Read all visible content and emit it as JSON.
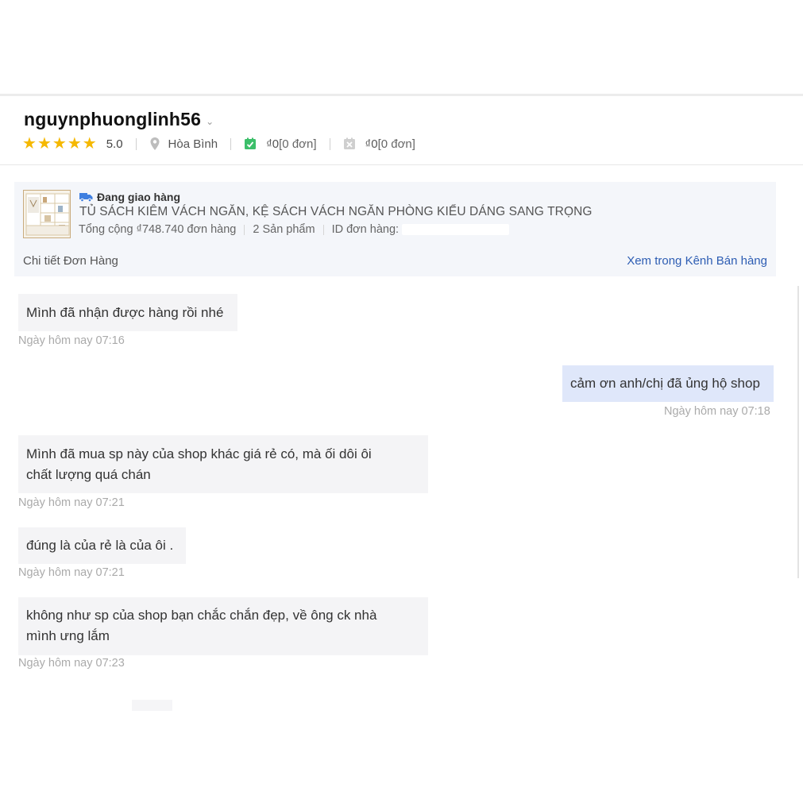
{
  "header": {
    "username": "nguynphuonglinh56",
    "rating": "5.0",
    "location": "Hòa Bình",
    "completed": {
      "currency": "₫0",
      "count": "[0 đơn]"
    },
    "cancelled": {
      "currency": "₫0",
      "count": "[0 đơn]"
    },
    "icons": {
      "stars": "star-icon",
      "location": "map-pin-icon",
      "completed": "check-box-icon",
      "cancelled": "x-box-icon",
      "expand": "chevron-down-icon"
    }
  },
  "order": {
    "status": "Đang giao hàng",
    "title": "TỦ SÁCH KIÊM VÁCH NGĂN, KỆ SÁCH VÁCH NGĂN PHÒNG KIỂU DÁNG SANG TRỌNG",
    "total": "Tổng cộng ₫748.740 đơn hàng",
    "products": "2 Sản phẩm",
    "id_label": "ID đơn hàng:",
    "detail_link": "Chi tiết Đơn Hàng",
    "channel_link": "Xem trong Kênh Bán hàng",
    "status_icon": "truck-icon"
  },
  "messages": [
    {
      "lines": [
        "Mình đã nhận được hàng rồi nhé"
      ],
      "time": "Ngày hôm nay 07:16",
      "side": "in"
    },
    {
      "lines": [
        "cảm ơn anh/chị đã ủng hộ shop"
      ],
      "time": "Ngày hôm nay 07:18",
      "side": "out"
    },
    {
      "lines": [
        "Mình đã mua sp này của shop khác giá rẻ có, mà ối dôi ôi",
        "chất lượng quá chán"
      ],
      "time": "Ngày hôm nay 07:21",
      "side": "in"
    },
    {
      "lines": [
        "đúng là của rẻ là của ôi ."
      ],
      "time": "Ngày hôm nay 07:21",
      "side": "in"
    },
    {
      "lines": [
        "không như sp của shop bạn chắc chắn đẹp, về ông ck nhà",
        "mình ưng lắm"
      ],
      "time": "Ngày hôm nay 07:23",
      "side": "in"
    }
  ],
  "colors": {
    "accent_link": "#2d5db3",
    "outgoing_bubble": "#dfe7fa",
    "incoming_bubble": "#f4f4f6",
    "star": "#f5b800",
    "check": "#3cbf6a"
  }
}
